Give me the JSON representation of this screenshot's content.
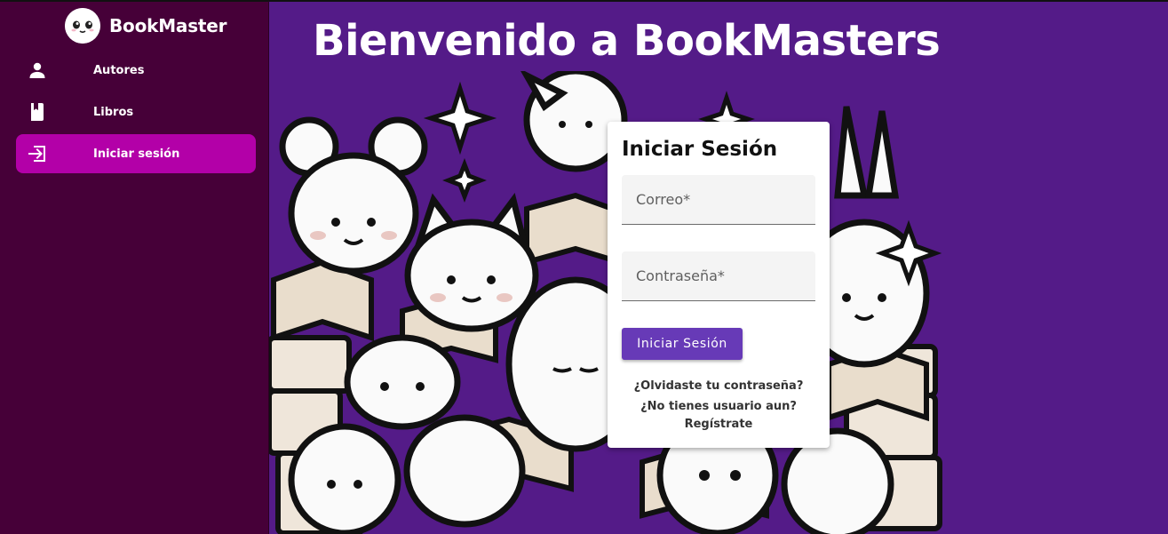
{
  "brand": {
    "name": "BookMaster",
    "logo_icon": "face-logo-icon"
  },
  "sidebar": {
    "items": [
      {
        "label": "Autores",
        "icon": "person-icon"
      },
      {
        "label": "Libros",
        "icon": "book-icon"
      },
      {
        "label": "Iniciar sesión",
        "icon": "login-icon",
        "active": true
      }
    ]
  },
  "main": {
    "title": "Bienvenido a BookMasters"
  },
  "login": {
    "title": "Iniciar Sesión",
    "email_placeholder": "Correo*",
    "password_placeholder": "Contraseña*",
    "submit_label": "Iniciar Sesión",
    "forgot_link": "¿Olvidaste tu contraseña?",
    "no_account_text": "¿No tienes usuario aun?",
    "register_link": "Regístrate"
  },
  "colors": {
    "sidebar_bg": "#460038",
    "active_item": "#b300a8",
    "main_bg": "#541b88",
    "button": "#673ab7"
  }
}
